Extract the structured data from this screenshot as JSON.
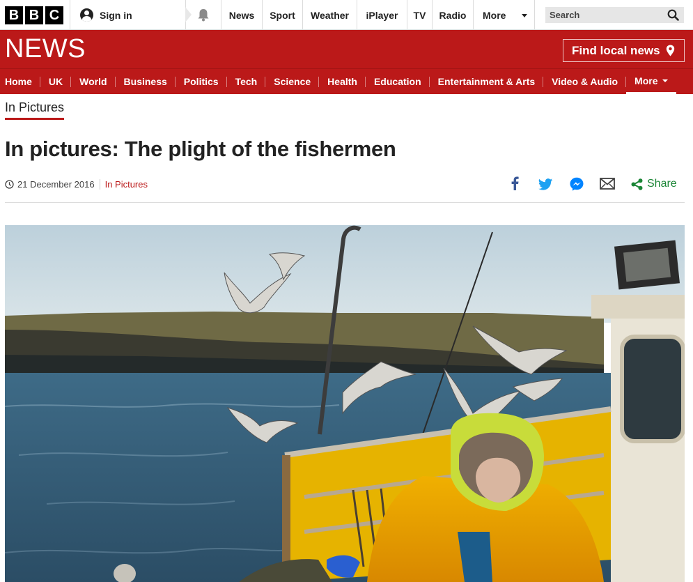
{
  "bbc_logo": [
    "B",
    "B",
    "C"
  ],
  "account": {
    "sign_in": "Sign in"
  },
  "top_nav": [
    "News",
    "Sport",
    "Weather",
    "iPlayer",
    "TV",
    "Radio",
    "More"
  ],
  "search": {
    "placeholder": "Search"
  },
  "masthead": {
    "logo": "NEWS",
    "find_local": "Find local news"
  },
  "section_nav": [
    "Home",
    "UK",
    "World",
    "Business",
    "Politics",
    "Tech",
    "Science",
    "Health",
    "Education",
    "Entertainment & Arts",
    "Video & Audio",
    "More"
  ],
  "article": {
    "section": "In Pictures",
    "title": "In pictures: The plight of the fishermen",
    "date": "21 December 2016",
    "category": "In Pictures",
    "share_label": "Share"
  },
  "colors": {
    "brand_red": "#bb1919",
    "share_green": "#1a8535",
    "facebook": "#3b5998",
    "twitter": "#1da1f2",
    "messenger": "#0084ff"
  },
  "icons": [
    "user-icon",
    "bell-icon",
    "search-icon",
    "location-pin-icon",
    "clock-icon",
    "facebook-icon",
    "twitter-icon",
    "messenger-icon",
    "email-icon",
    "share-icon"
  ]
}
